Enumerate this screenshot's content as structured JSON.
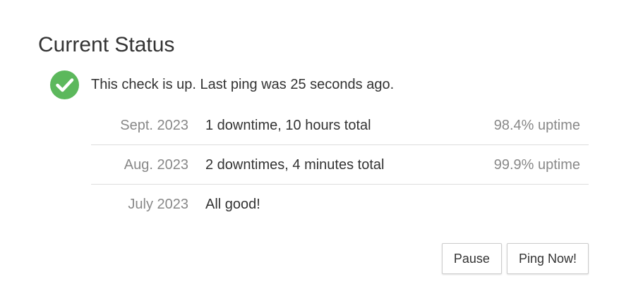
{
  "page": {
    "title": "Current Status"
  },
  "status": {
    "icon": "check-circle-icon",
    "icon_color": "#5cb85c",
    "text": "This check is up. Last ping was 25 seconds ago."
  },
  "history": [
    {
      "month": "Sept. 2023",
      "description": "1 downtime, 10 hours total",
      "uptime": "98.4% uptime"
    },
    {
      "month": "Aug. 2023",
      "description": "2 downtimes, 4 minutes total",
      "uptime": "99.9% uptime"
    },
    {
      "month": "July 2023",
      "description": "All good!",
      "uptime": ""
    }
  ],
  "actions": {
    "pause_label": "Pause",
    "ping_now_label": "Ping Now!"
  }
}
